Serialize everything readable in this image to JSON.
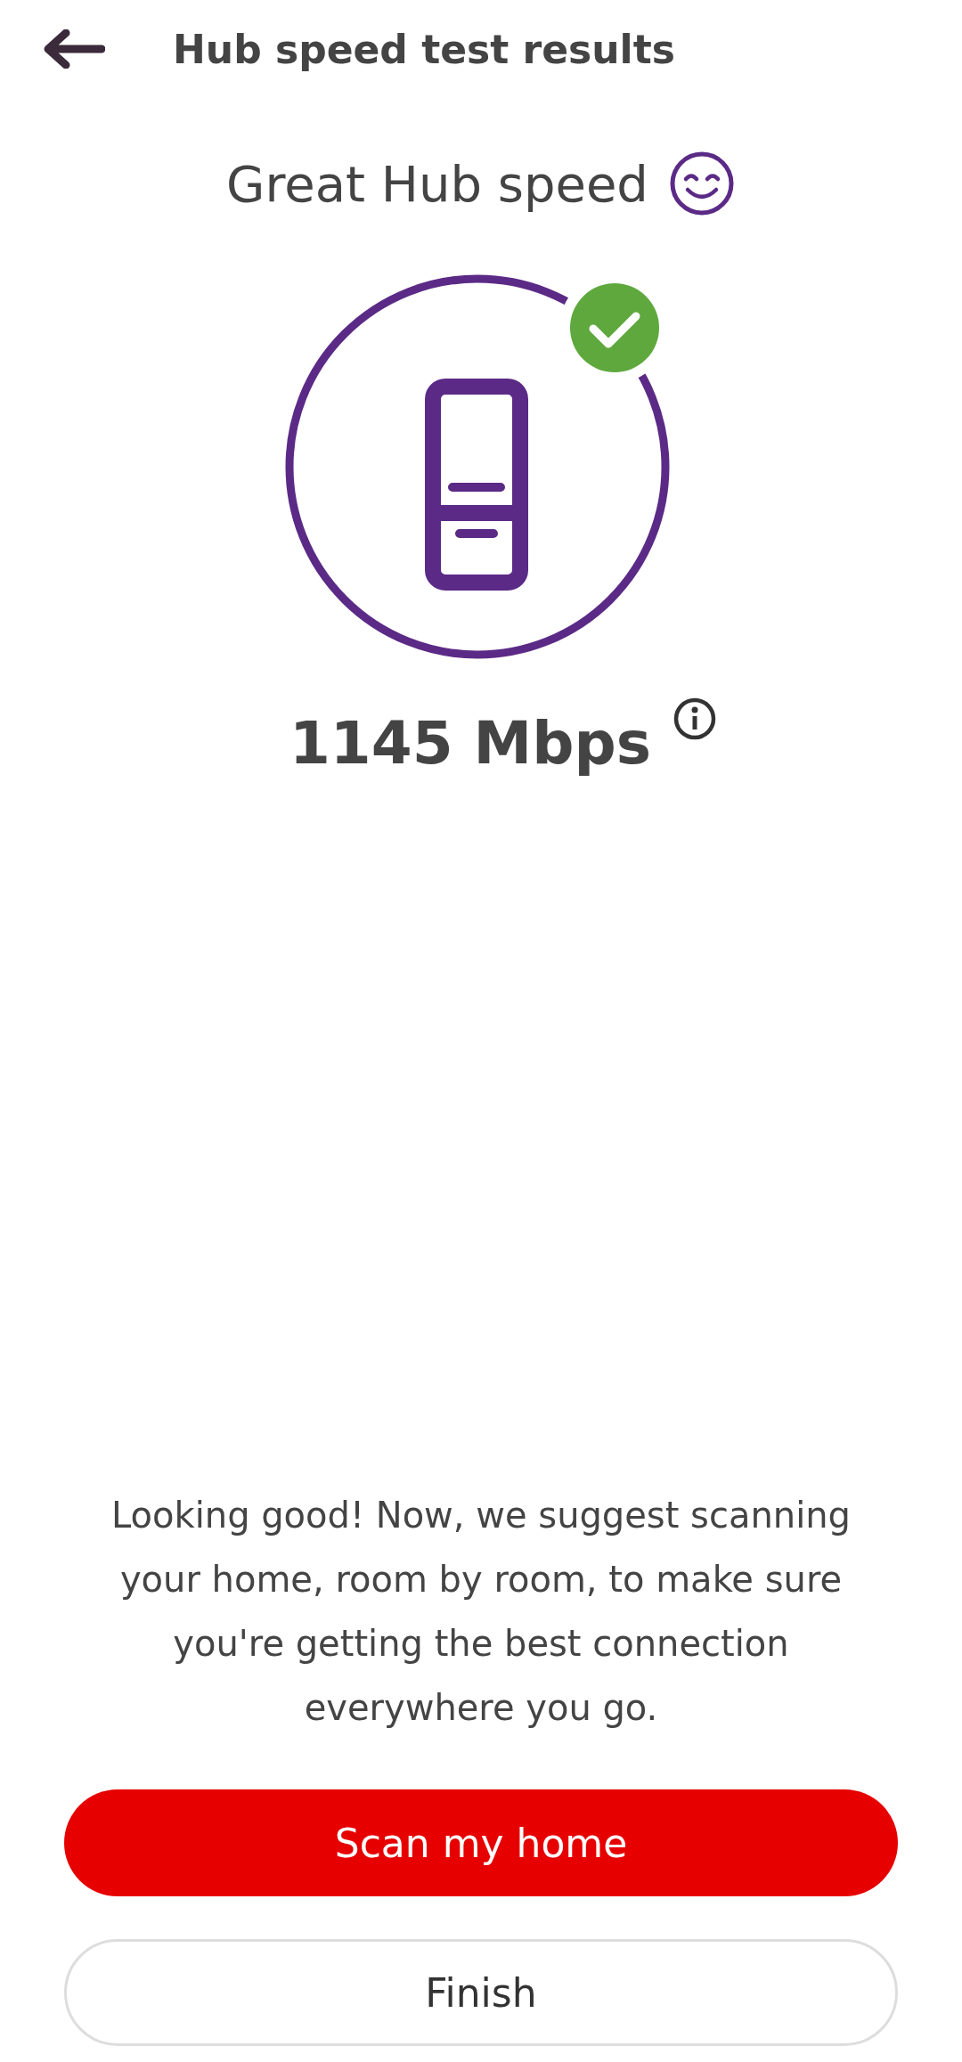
{
  "header": {
    "title": "Hub speed test results"
  },
  "result": {
    "heading": "Great Hub speed",
    "speed": "1145 Mbps"
  },
  "message": "Looking good! Now, we suggest scanning your home, room by room, to make sure you're getting the best connection everywhere you go.",
  "buttons": [
    {
      "label": "Scan my home",
      "kind": "primary"
    },
    {
      "label": "Finish",
      "kind": "secondary"
    }
  ]
}
